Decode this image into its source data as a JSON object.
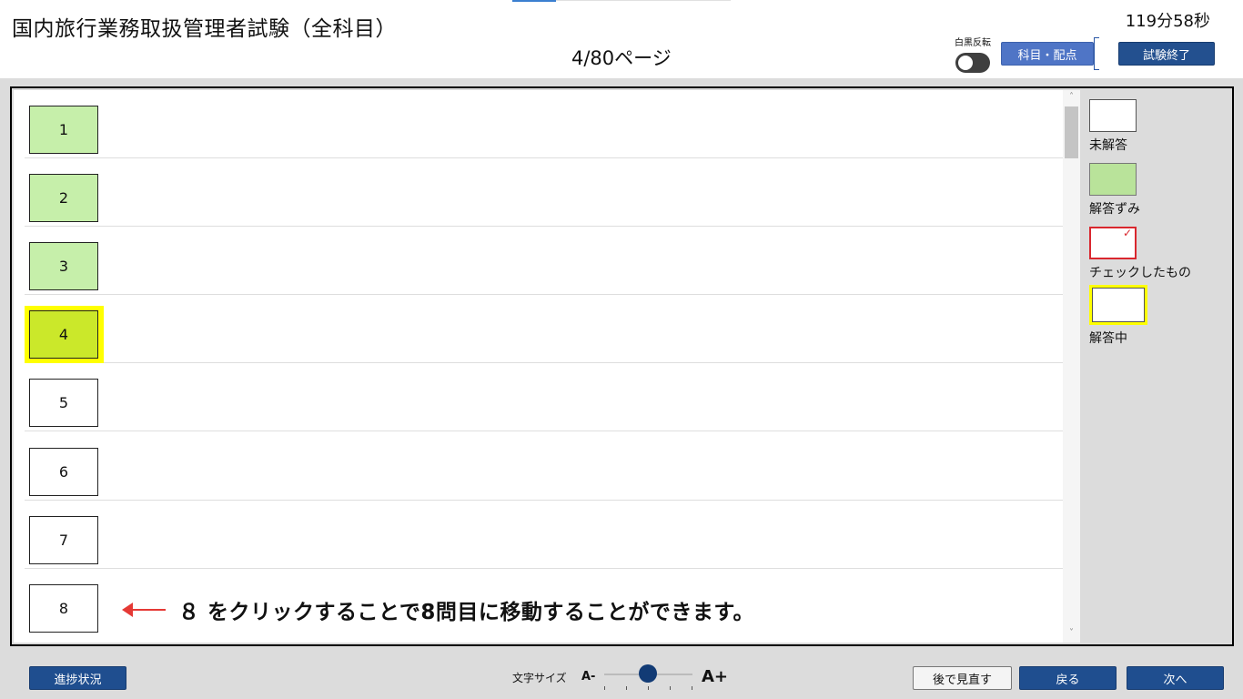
{
  "header": {
    "exam_title": "国内旅行業務取扱管理者試験（全科目）",
    "timer": "119分58秒",
    "page_indicator": "4/80ページ",
    "invert_label": "白黒反転",
    "subject_button": "科目・配点",
    "end_button": "試験終了"
  },
  "questions": [
    {
      "number": "1",
      "status": "answered"
    },
    {
      "number": "2",
      "status": "answered"
    },
    {
      "number": "3",
      "status": "answered"
    },
    {
      "number": "4",
      "status": "current"
    },
    {
      "number": "5",
      "status": "unanswered"
    },
    {
      "number": "6",
      "status": "unanswered"
    },
    {
      "number": "7",
      "status": "unanswered"
    },
    {
      "number": "8",
      "status": "unanswered"
    }
  ],
  "annotation": {
    "text": "８ をクリックすることで8問目に移動することができます。",
    "arrow_color": "#e53935"
  },
  "legend": {
    "unanswered": "未解答",
    "answered": "解答ずみ",
    "checked": "チェックしたもの",
    "current": "解答中"
  },
  "footer": {
    "progress_button": "進捗状況",
    "font_size_label": "文字サイズ",
    "font_minus": "A-",
    "font_plus": "A+",
    "review_button": "後で見直す",
    "back_button": "戻る",
    "next_button": "次へ"
  },
  "colors": {
    "answered": "#c6efaa",
    "current": "#cbe82a",
    "current_frame": "#ffff00",
    "primary_button": "#1f4e8f",
    "check_red": "#d9272e"
  },
  "icons": {
    "toggle": "toggle-switch-icon",
    "scroll_up": "chevron-up-icon",
    "scroll_down": "chevron-down-icon",
    "check": "check-icon",
    "arrow": "arrow-left-icon"
  }
}
